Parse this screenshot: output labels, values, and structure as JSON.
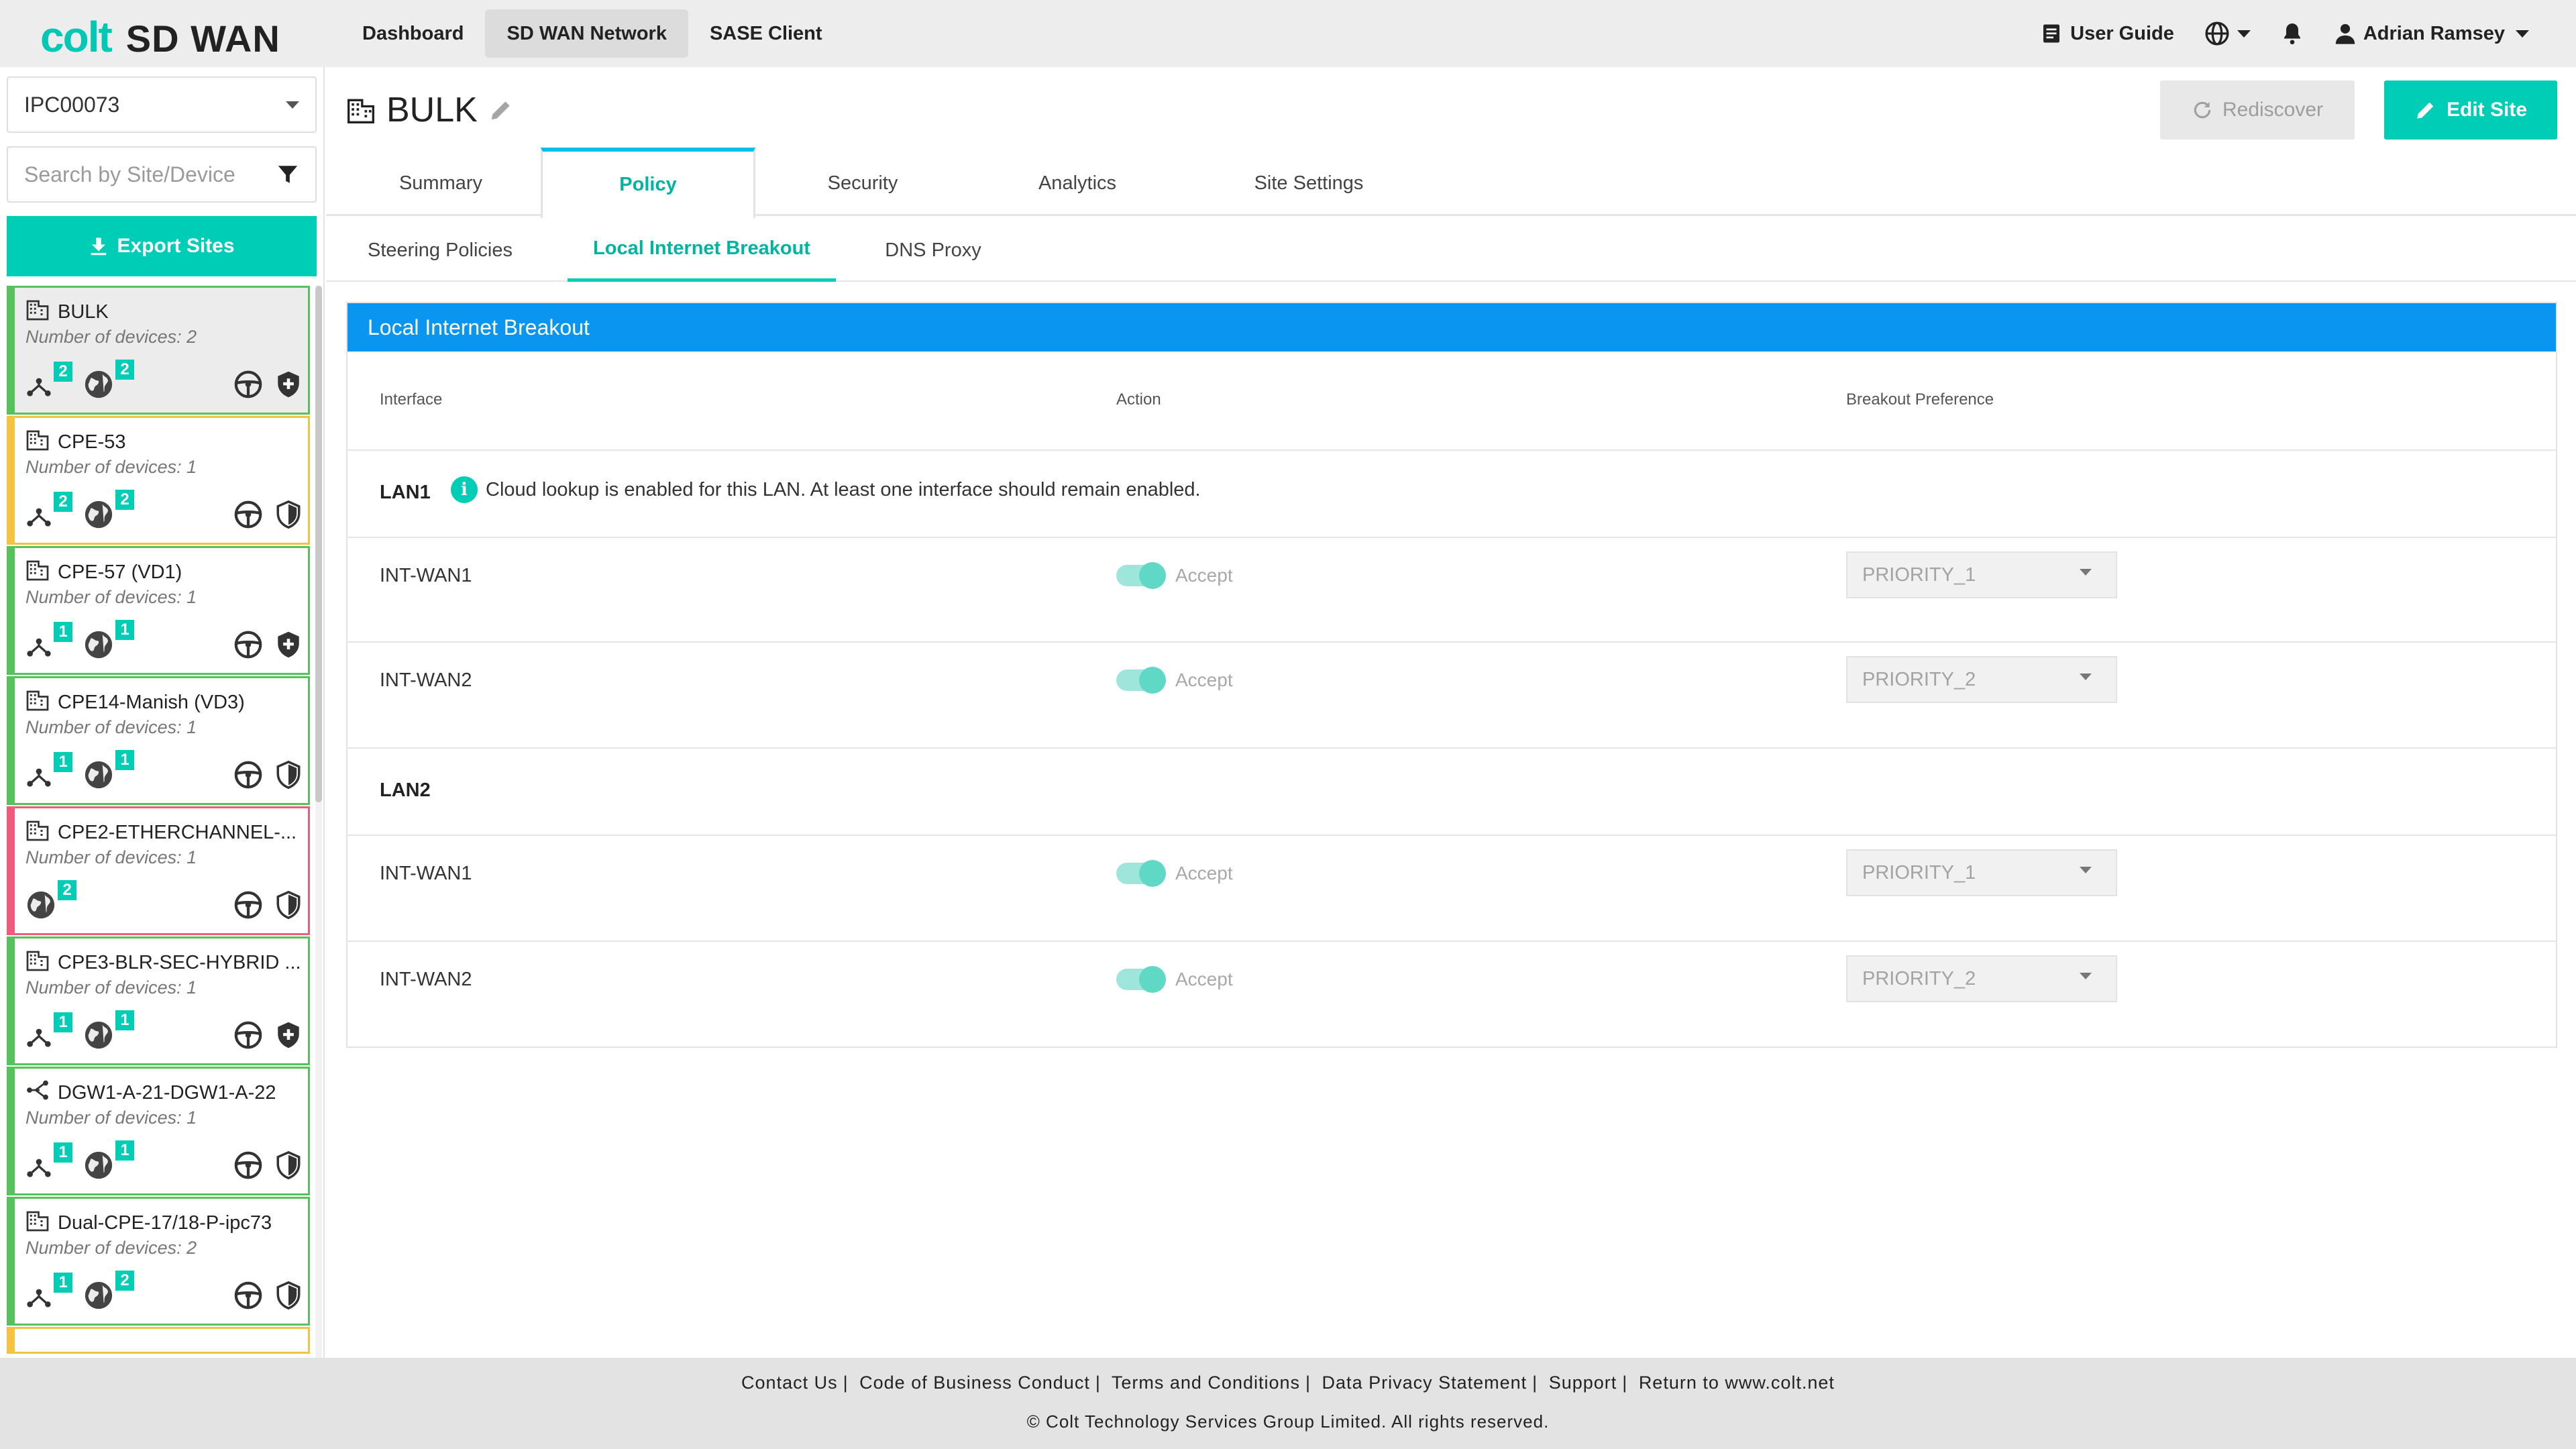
{
  "header": {
    "brand": "colt",
    "product": "SD WAN",
    "nav": [
      "Dashboard",
      "SD WAN Network",
      "SASE Client"
    ],
    "user_guide": "User Guide",
    "user_name": "Adrian Ramsey"
  },
  "sidebar": {
    "customer": "IPC00073",
    "search_placeholder": "Search by Site/Device",
    "export_label": "Export Sites",
    "sites": [
      {
        "name": "BULK",
        "devices": "Number of devices: 2",
        "status": "green",
        "selected": true,
        "icon": "building-icon",
        "link_count": "2",
        "globe_count": "2",
        "shield": "shield-plus-icon"
      },
      {
        "name": "CPE-53",
        "devices": "Number of devices: 1",
        "status": "yellow",
        "selected": false,
        "icon": "building-icon",
        "link_count": "2",
        "globe_count": "2",
        "shield": "shield-icon"
      },
      {
        "name": "CPE-57 (VD1)",
        "devices": "Number of devices: 1",
        "status": "green",
        "selected": false,
        "icon": "building-icon",
        "link_count": "1",
        "globe_count": "1",
        "shield": "shield-plus-icon"
      },
      {
        "name": "CPE14-Manish (VD3)",
        "devices": "Number of devices: 1",
        "status": "green",
        "selected": false,
        "icon": "building-icon",
        "link_count": "1",
        "globe_count": "1",
        "shield": "shield-icon"
      },
      {
        "name": "CPE2-ETHERCHANNEL-...",
        "devices": "Number of devices: 1",
        "status": "red",
        "selected": false,
        "icon": "building-icon",
        "link_count": "",
        "globe_count": "2",
        "shield": "shield-icon"
      },
      {
        "name": "CPE3-BLR-SEC-HYBRID ...",
        "devices": "Number of devices: 1",
        "status": "green",
        "selected": false,
        "icon": "building-icon",
        "link_count": "1",
        "globe_count": "1",
        "shield": "shield-plus-icon"
      },
      {
        "name": "DGW1-A-21-DGW1-A-22",
        "devices": "Number of devices: 1",
        "status": "green",
        "selected": false,
        "icon": "gateway-icon",
        "link_count": "1",
        "globe_count": "1",
        "shield": "shield-icon"
      },
      {
        "name": "Dual-CPE-17/18-P-ipc73",
        "devices": "Number of devices: 2",
        "status": "green",
        "selected": false,
        "icon": "building-icon",
        "link_count": "1",
        "globe_count": "2",
        "shield": "shield-icon"
      }
    ]
  },
  "page": {
    "title": "BULK",
    "rediscover_label": "Rediscover",
    "edit_label": "Edit Site",
    "tabs": [
      "Summary",
      "Policy",
      "Security",
      "Analytics",
      "Site Settings"
    ],
    "active_tab": "Policy",
    "subtabs": [
      "Steering Policies",
      "Local Internet Breakout",
      "DNS Proxy"
    ],
    "active_subtab": "Local Internet Breakout"
  },
  "lib": {
    "panel_title": "Local Internet Breakout",
    "columns": [
      "Interface",
      "Action",
      "Breakout Preference"
    ],
    "lans": [
      {
        "name": "LAN1",
        "note": "Cloud lookup is enabled for this LAN. At least one interface should remain enabled.",
        "rows": [
          {
            "interface": "INT-WAN1",
            "enabled": true,
            "action": "Accept",
            "preference": "PRIORITY_1"
          },
          {
            "interface": "INT-WAN2",
            "enabled": true,
            "action": "Accept",
            "preference": "PRIORITY_2"
          }
        ]
      },
      {
        "name": "LAN2",
        "note": "",
        "rows": [
          {
            "interface": "INT-WAN1",
            "enabled": true,
            "action": "Accept",
            "preference": "PRIORITY_1"
          },
          {
            "interface": "INT-WAN2",
            "enabled": true,
            "action": "Accept",
            "preference": "PRIORITY_2"
          }
        ]
      }
    ]
  },
  "footer": {
    "links": [
      "Contact Us",
      "Code of Business Conduct",
      "Terms and Conditions",
      "Data Privacy Statement",
      "Support",
      "Return to www.colt.net"
    ],
    "copyright": "© Colt Technology Services Group Limited. All rights reserved."
  },
  "colors": {
    "accent": "#00cdb5",
    "header_blue": "#0a96f0",
    "ok": "#55c25c",
    "warn": "#f5c242",
    "error": "#ef5b7a"
  }
}
